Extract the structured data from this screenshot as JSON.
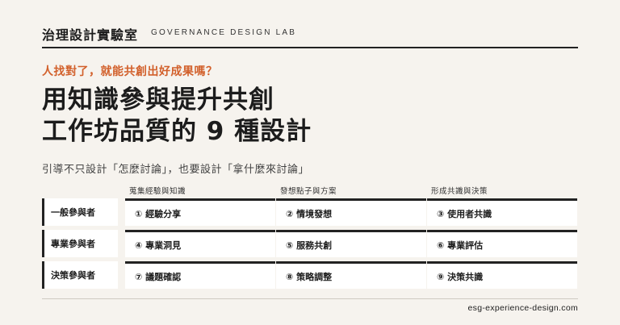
{
  "header": {
    "brand": "治理設計實驗室",
    "brand_en": "GOVERNANCE DESIGN LAB"
  },
  "tagline": "人找對了，就能共創出好成果嗎？",
  "title": {
    "line1": "用知識參與提升共創",
    "line2": "工作坊品質的 9 種設計"
  },
  "subtitle": "引導不只設計「怎麼討論」，也要設計「拿什麼來討論」",
  "grid": {
    "columns": [
      "蒐集經驗與知識",
      "發想點子與方案",
      "形成共識與決策"
    ],
    "rows": [
      {
        "label": "一般參與者",
        "cells": [
          "① 經驗分享",
          "② 情境發想",
          "③ 使用者共識"
        ]
      },
      {
        "label": "專業參與者",
        "cells": [
          "④ 專業洞見",
          "⑤ 服務共創",
          "⑥ 專業評估"
        ]
      },
      {
        "label": "決策參與者",
        "cells": [
          "⑦ 議題確認",
          "⑧ 策略調整",
          "⑨ 決策共識"
        ]
      }
    ]
  },
  "footer": "esg-experience-design.com"
}
